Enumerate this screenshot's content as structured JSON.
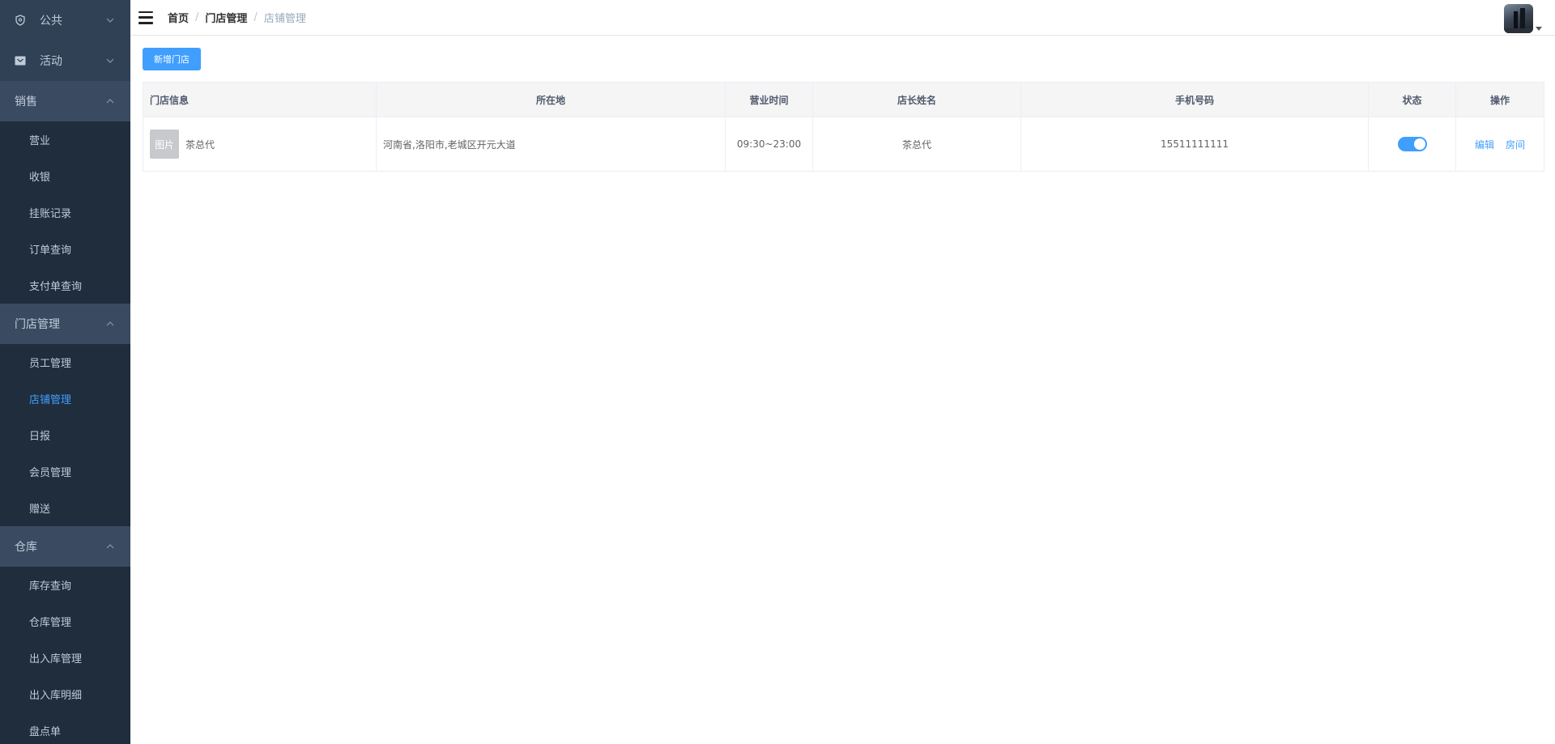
{
  "sidebar": {
    "groups": [
      {
        "label": "公共",
        "icon": "shield-icon",
        "open": false,
        "items": []
      },
      {
        "label": "活动",
        "icon": "ticket-icon",
        "open": false,
        "items": []
      },
      {
        "label": "销售",
        "open": true,
        "items": [
          {
            "label": "营业"
          },
          {
            "label": "收银"
          },
          {
            "label": "挂账记录"
          },
          {
            "label": "订单查询"
          },
          {
            "label": "支付单查询"
          }
        ]
      },
      {
        "label": "门店管理",
        "open": true,
        "items": [
          {
            "label": "员工管理"
          },
          {
            "label": "店铺管理",
            "active": true
          },
          {
            "label": "日报"
          },
          {
            "label": "会员管理"
          },
          {
            "label": "赠送"
          }
        ]
      },
      {
        "label": "仓库",
        "open": true,
        "items": [
          {
            "label": "库存查询"
          },
          {
            "label": "仓库管理"
          },
          {
            "label": "出入库管理"
          },
          {
            "label": "出入库明细"
          },
          {
            "label": "盘点单"
          }
        ]
      }
    ]
  },
  "header": {
    "breadcrumb": [
      "首页",
      "门店管理",
      "店铺管理"
    ],
    "breadcrumb_separator": "/"
  },
  "main": {
    "add_button_label": "新增门店",
    "table": {
      "columns": [
        "门店信息",
        "所在地",
        "营业时间",
        "店长姓名",
        "手机号码",
        "状态",
        "操作"
      ],
      "rows": [
        {
          "thumb_label": "图片",
          "store_name": "茶总代",
          "location": "河南省,洛阳市,老城区开元大道",
          "hours": "09:30~23:00",
          "manager": "茶总代",
          "phone": "15511111111",
          "status_enabled": true,
          "actions": [
            "编辑",
            "房间"
          ]
        }
      ]
    }
  },
  "colors": {
    "sidebar_bg": "#304156",
    "submenu_bg": "#1f2d3d",
    "accent": "#409eff"
  }
}
